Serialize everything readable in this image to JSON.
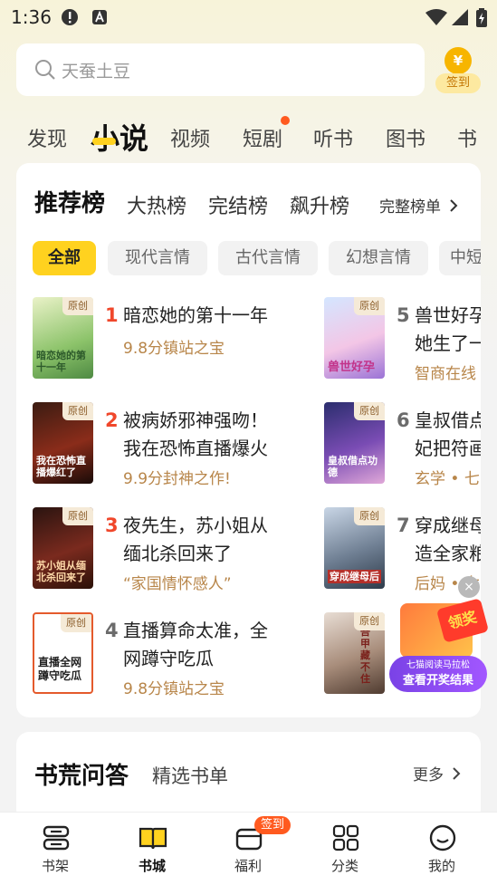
{
  "status_bar": {
    "time": "1:36"
  },
  "search": {
    "placeholder": "天蚕土豆"
  },
  "signin": {
    "coin": "¥",
    "label": "签到"
  },
  "top_tabs": [
    "发现",
    "小说",
    "视频",
    "短剧",
    "听书",
    "图书",
    "书"
  ],
  "ranking": {
    "tabs": [
      "推荐榜",
      "大热榜",
      "完结榜",
      "飙升榜"
    ],
    "more_label": "完整榜单",
    "chips": [
      "全部",
      "现代言情",
      "古代言情",
      "幻想言情",
      "中短"
    ],
    "origin_tag": "原创",
    "books": [
      {
        "rank": "1",
        "title_lines": [
          "暗恋她的第十一年"
        ],
        "sub": "9.8分镇站之宝",
        "cover_text": "暗恋她的第十一年"
      },
      {
        "rank": "2",
        "title_lines": [
          "被病娇邪神强吻！",
          "我在恐怖直播爆火"
        ],
        "sub": "9.9分封神之作!",
        "cover_text": "我在恐怖直播爆红了"
      },
      {
        "rank": "3",
        "title_lines": [
          "夜先生，苏小姐从",
          "缅北杀回来了"
        ],
        "sub": "“家国情怀感人”",
        "cover_text": "苏小姐从缅北杀回来了"
      },
      {
        "rank": "4",
        "title_lines": [
          "直播算命太准，全",
          "网蹲守吃瓜"
        ],
        "sub": "9.8分镇站之宝",
        "cover_text": "直播全网蹲守吃瓜"
      },
      {
        "rank": "5",
        "title_lines": [
          "兽世好孕",
          "她生了一"
        ],
        "sub": "智商在线",
        "cover_text": "兽世好孕"
      },
      {
        "rank": "6",
        "title_lines": [
          "皇叔借点",
          "妃把符画"
        ],
        "sub": "玄学 • 七",
        "cover_text": "皇叔借点功德"
      },
      {
        "rank": "7",
        "title_lines": [
          "穿成继母",
          "造全家粮"
        ],
        "sub": "后妈 • 女",
        "cover_text": "穿成继母后"
      },
      {
        "rank": "8",
        "title_lines": [
          "",
          ""
        ],
        "sub": "",
        "cover_text": "吾甲藏不住"
      }
    ]
  },
  "float_ad": {
    "badge": "领奖",
    "line1": "七猫阅读马拉松",
    "line2": "查看开奖结果",
    "close": "×"
  },
  "card2": {
    "title": "书荒问答",
    "subtitle": "精选书单",
    "more_label": "更多"
  },
  "bottom_nav": [
    {
      "label": "书架"
    },
    {
      "label": "书城"
    },
    {
      "label": "福利",
      "badge": "签到"
    },
    {
      "label": "分类"
    },
    {
      "label": "我的"
    }
  ],
  "colors": {
    "accent": "#ffd21f",
    "rank_red": "#f0472b",
    "rank_gray": "#6b6b6b",
    "sub_gold": "#b8864a"
  }
}
